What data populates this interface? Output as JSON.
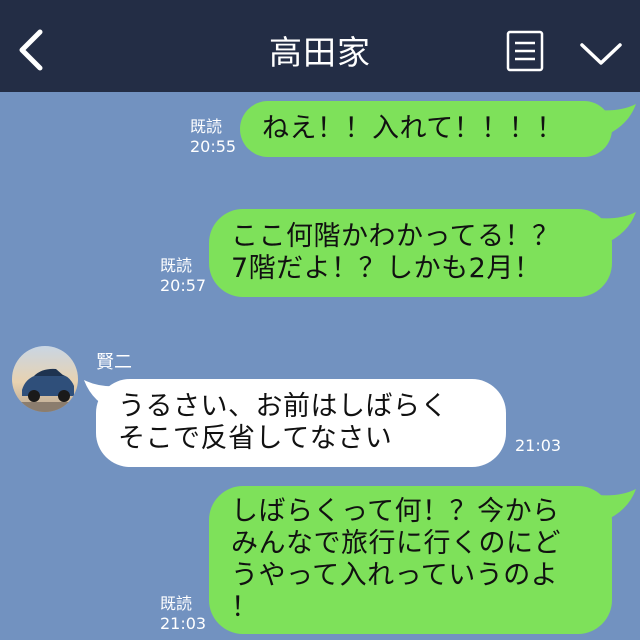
{
  "header": {
    "title": "高田家"
  },
  "messages": [
    {
      "side": "right",
      "text": "ねえ！！入れて！！！！",
      "read": "既読",
      "time": "20:55"
    },
    {
      "side": "right",
      "lines": [
        "ここ何階かわかってる！？",
        "7階だよ！？しかも2月！"
      ],
      "read": "既読",
      "time": "20:57"
    },
    {
      "side": "left",
      "sender": "賢二",
      "lines": [
        "うるさい、お前はしばらく",
        "そこで反省してなさい"
      ],
      "time": "21:03"
    },
    {
      "side": "right",
      "lines": [
        "しばらくって何！？今から",
        "みんなで旅行に行くのにど",
        "うやって入れっていうのよ",
        "！"
      ],
      "read": "既読",
      "time": "21:03"
    }
  ],
  "colors": {
    "background": "#7292c0",
    "header": "#232d45",
    "green_bubble": "#7ee15a",
    "white_bubble": "#ffffff"
  },
  "icons": {
    "back": "chevron-left-icon",
    "menu": "menu-list-icon",
    "collapse": "chevron-down-icon"
  }
}
